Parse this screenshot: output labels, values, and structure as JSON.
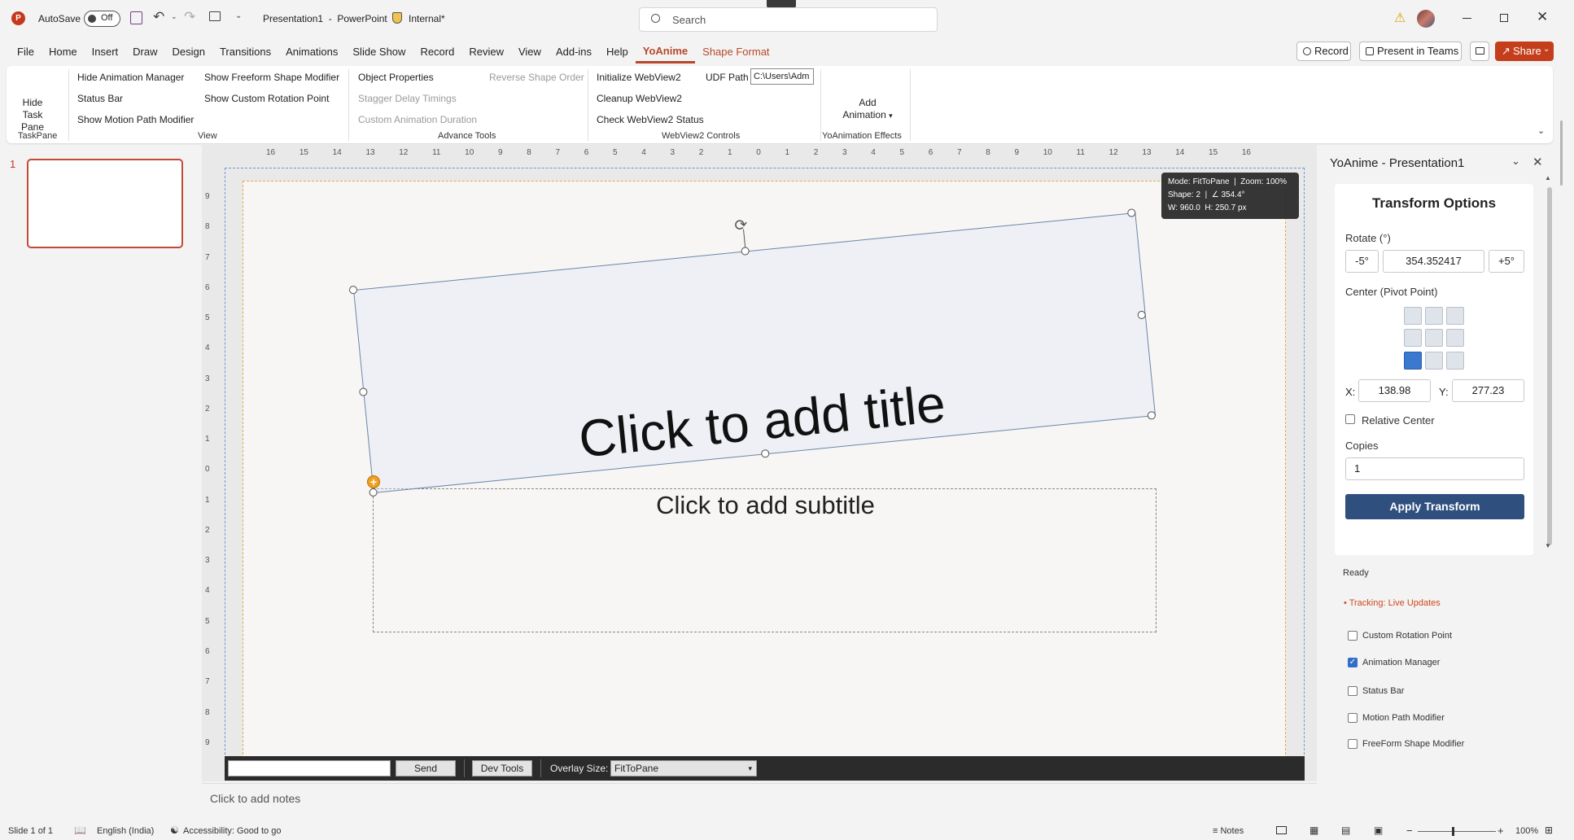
{
  "title_bar": {
    "autosave_label": "AutoSave",
    "autosave_state": "Off",
    "document_title": "Presentation1  -  PowerPoint",
    "sensitivity_label": "Internal*",
    "search_placeholder": "Search"
  },
  "menu_tabs": [
    "File",
    "Home",
    "Insert",
    "Draw",
    "Design",
    "Transitions",
    "Animations",
    "Slide Show",
    "Record",
    "Review",
    "View",
    "Add-ins",
    "Help",
    "YoAnime",
    "Shape Format"
  ],
  "menu_right": {
    "record_label": "Record",
    "present_teams_label": "Present in Teams",
    "share_label": "Share"
  },
  "ribbon": {
    "taskpane": {
      "button": "Hide Task Pane",
      "group": "TaskPane"
    },
    "view": {
      "items": [
        "Hide Animation Manager",
        "Status Bar",
        "Show Motion Path Modifier",
        "Show Freeform Shape Modifier",
        "Show Custom Rotation Point"
      ],
      "group": "View"
    },
    "advance_tools": {
      "items": [
        "Object Properties",
        "Stagger Delay Timings",
        "Custom Animation Duration",
        "Reverse Shape Order"
      ],
      "group": "Advance Tools"
    },
    "webview2": {
      "items": [
        "Initialize WebView2",
        "Cleanup WebView2",
        "Check WebView2 Status"
      ],
      "udf_label": "UDF Path",
      "udf_value": "C:\\Users\\Adm",
      "group": "WebView2 Controls"
    },
    "effects": {
      "button_line1": "Add",
      "button_line2": "Animation",
      "group": "YoAnimation Effects"
    }
  },
  "thumbnails": {
    "number": "1"
  },
  "ruler": {
    "h_ticks": [
      "16",
      "15",
      "14",
      "13",
      "12",
      "11",
      "10",
      "9",
      "8",
      "7",
      "6",
      "5",
      "4",
      "3",
      "2",
      "1",
      "0",
      "1",
      "2",
      "3",
      "4",
      "5",
      "6",
      "7",
      "8",
      "9",
      "10",
      "11",
      "12",
      "13",
      "14",
      "15",
      "16"
    ],
    "v_ticks": [
      "9",
      "8",
      "7",
      "6",
      "5",
      "4",
      "3",
      "2",
      "1",
      "0",
      "1",
      "2",
      "3",
      "4",
      "5",
      "6",
      "7",
      "8",
      "9"
    ]
  },
  "slide": {
    "title_placeholder": "Click to add title",
    "subtitle_placeholder": "Click to add subtitle",
    "rotation_deg": 354.352417
  },
  "info_tooltip": {
    "line1": "Mode: FitToPane  |  Zoom: 100%",
    "line2": "Shape: 2  |  ∠ 354.4°",
    "line3": "W: 960.0  H: 250.7 px"
  },
  "overlay_bar": {
    "send_label": "Send",
    "devtools_label": "Dev Tools",
    "size_label": "Overlay Size:",
    "size_value": "FitToPane"
  },
  "notes_placeholder": "Click to add notes",
  "task_pane": {
    "title": "YoAnime - Presentation1",
    "card_title": "Transform Options",
    "rotate_label": "Rotate (°)",
    "minus_label": "-5°",
    "rotate_value": "354.352417",
    "plus_label": "+5°",
    "center_label": "Center (Pivot Point)",
    "pivot_selected": 6,
    "x_label": "X:",
    "x_value": "138.98",
    "y_label": "Y:",
    "y_value": "277.23",
    "relative_center_label": "Relative Center",
    "copies_label": "Copies",
    "copies_value": "1",
    "apply_label": "Apply Transform",
    "status_text": "Ready",
    "tracking_text": "• Tracking: Live Updates",
    "checkboxes": [
      {
        "label": "Custom Rotation Point",
        "checked": false
      },
      {
        "label": "Animation Manager",
        "checked": true
      },
      {
        "label": "Status Bar",
        "checked": false
      },
      {
        "label": "Motion Path Modifier",
        "checked": false
      },
      {
        "label": "FreeForm Shape Modifier",
        "checked": false
      }
    ]
  },
  "status_bar": {
    "slide_info": "Slide 1 of 1",
    "language": "English (India)",
    "accessibility": "Accessibility: Good to go",
    "notes_label": "Notes",
    "zoom": "100%"
  },
  "colors": {
    "accent": "#b7472a",
    "apply_button": "#2f4f7f",
    "pivot_selected": "#3b78d0",
    "tracking": "#d0471c"
  }
}
